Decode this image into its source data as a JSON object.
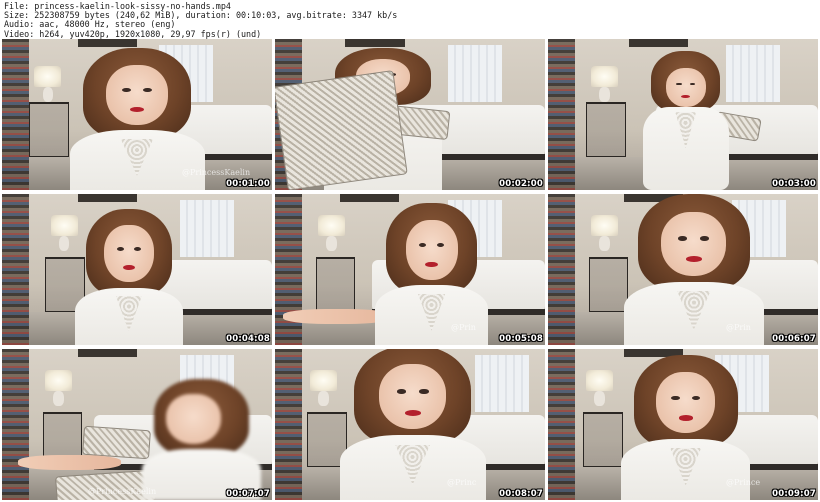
{
  "header": {
    "file_line": "File: princess-kaelin-look-sissy-no-hands.mp4",
    "size_line": "Size: 252308759 bytes (240,62 MiB), duration: 00:10:03, avg.bitrate: 3347 kb/s",
    "audio_line": "Audio: aac, 48000 Hz, stereo (eng)",
    "video_line": "Video: h264, yuv420p, 1920x1080, 29,97 fps(r) (und)"
  },
  "frames": [
    {
      "timestamp": "00:01:00",
      "watermark": "@PrincessKaelin"
    },
    {
      "timestamp": "00:02:00",
      "watermark": ""
    },
    {
      "timestamp": "00:03:00",
      "watermark": ""
    },
    {
      "timestamp": "00:04:08",
      "watermark": ""
    },
    {
      "timestamp": "00:05:08",
      "watermark": "@Prin"
    },
    {
      "timestamp": "00:06:07",
      "watermark": "@Prin"
    },
    {
      "timestamp": "00:07:07",
      "watermark": "@PrincessKaelin"
    },
    {
      "timestamp": "00:08:07",
      "watermark": "@Princ"
    },
    {
      "timestamp": "00:09:07",
      "watermark": "@Prince"
    }
  ]
}
